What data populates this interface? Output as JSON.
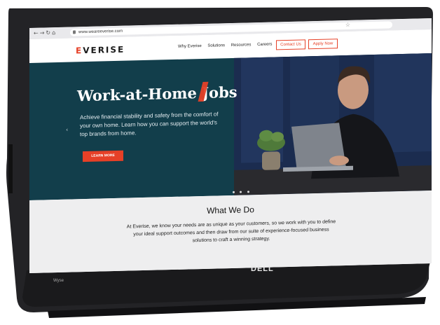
{
  "browser": {
    "url": "www.weareeverise.com"
  },
  "site": {
    "logo": "EVERISE",
    "logo_accent_letter": "E",
    "logo_rest": "VERISE",
    "nav": [
      "Why Everise",
      "Solutions",
      "Resources",
      "Careers"
    ],
    "contact_label": "Contact Us",
    "apply_label": "Apply Now"
  },
  "hero": {
    "title": "Work-at-Home Jobs",
    "text": "Achieve financial stability and safety from the comfort of your own home. Learn how you can support the world's top brands from home.",
    "button_label": "LEARN MORE",
    "carousel_dots": 3
  },
  "section": {
    "title": "What We Do",
    "text": "At Everise, we know your needs are as unique as your customers, so we work with you to define your ideal support outcomes and then draw from our suite of experience-focused business solutions to craft a winning strategy."
  },
  "device": {
    "brand": "DELL",
    "model": "Wyse"
  },
  "colors": {
    "accent": "#e64027",
    "hero_bg": "#123e4b",
    "section_bg": "#eeeeef",
    "bezel": "#1c1c1e"
  }
}
